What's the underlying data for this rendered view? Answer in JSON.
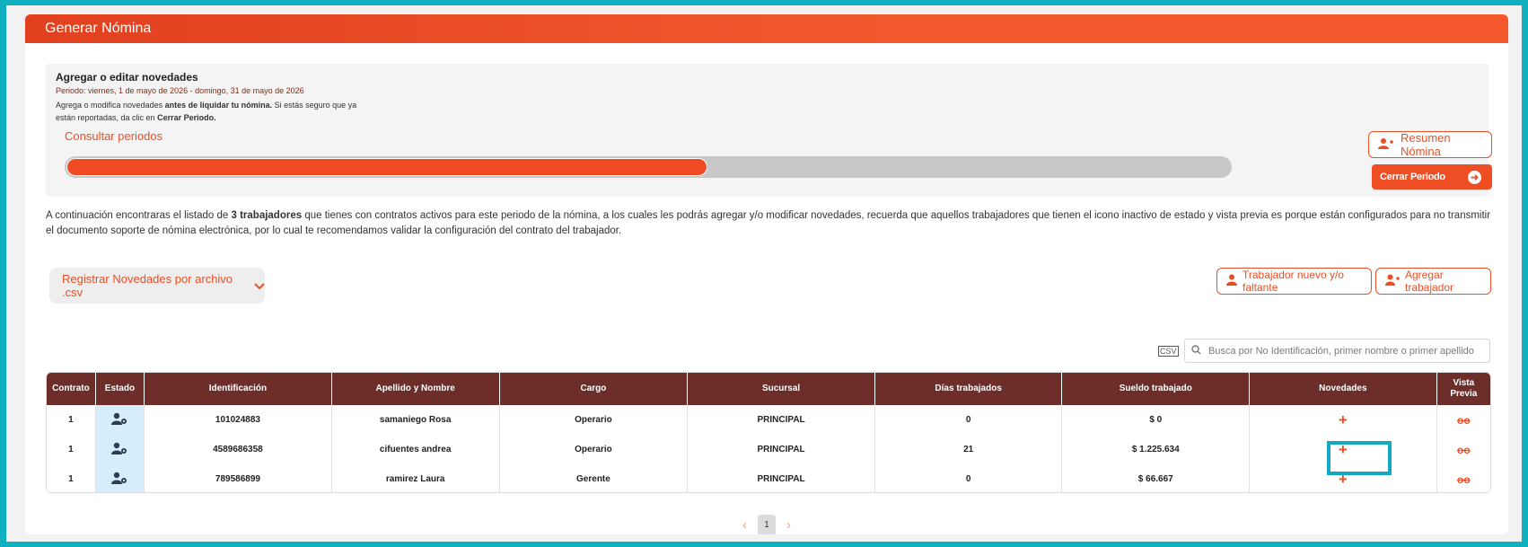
{
  "header": {
    "title": "Generar Nómina"
  },
  "novedades": {
    "title": "Agregar o editar novedades",
    "period": "Periodo: viernes, 1 de mayo de 2026 - domingo, 31 de mayo de 2026",
    "desc_part1": "Agrega o modifica novedades ",
    "desc_bold": "antes de liquidar tu nómina.",
    "desc_part2": " Si estás seguro que ya están reportadas, da clic en ",
    "desc_bold2": "Cerrar Periodo.",
    "consult_link": "Consultar periodos",
    "progress": 0.55,
    "resumen_button": "Resumen Nómina",
    "cerrar_button": "Cerrar Periodo"
  },
  "info": {
    "part1": "A continuación encontraras el listado de ",
    "bold": "3 trabajadores",
    "part2": " que tienes con contratos activos para este periodo de la nómina, a los cuales les podrás agregar y/o modificar novedades, recuerda que aquellos trabajadores que tienen el icono inactivo de estado y vista previa es porque están configurados para no transmitir el documento soporte de nómina electrónica, por lo cual te recomendamos validar la configuración del contrato del trabajador."
  },
  "actions": {
    "csv_button": "Registrar Novedades por archivo .csv",
    "nuevo_button": "Trabajador nuevo y/o faltante",
    "agregar_button": "Agregar trabajador"
  },
  "search": {
    "placeholder": "Busca por No Identificación, primer nombre o primer apellido",
    "csv_label": "CSV"
  },
  "table": {
    "columns": [
      "Contrato",
      "Estado",
      "Identificación",
      "Apellido y Nombre",
      "Cargo",
      "Sucursal",
      "Días trabajados",
      "Sueldo trabajado",
      "Novedades",
      "Vista Previa"
    ],
    "rows": [
      {
        "contrato": "1",
        "identificacion": "101024883",
        "nombre": "samaniego Rosa",
        "cargo": "Operario",
        "sucursal": "PRINCIPAL",
        "dias": "0",
        "sueldo": "$ 0"
      },
      {
        "contrato": "1",
        "identificacion": "4589686358",
        "nombre": "cifuentes andrea",
        "cargo": "Operario",
        "sucursal": "PRINCIPAL",
        "dias": "21",
        "sueldo": "$ 1.225.634"
      },
      {
        "contrato": "1",
        "identificacion": "789586899",
        "nombre": "ramirez Laura",
        "cargo": "Gerente",
        "sucursal": "PRINCIPAL",
        "dias": "0",
        "sueldo": "$ 66.667"
      }
    ]
  },
  "pagination": {
    "current": "1",
    "prev": "‹",
    "next": "›"
  },
  "colors": {
    "accent": "#ef4e24",
    "table_header": "#6d2e2a",
    "highlight": "#13a9c1"
  },
  "icons": {
    "plus": "+",
    "glasses": "oo"
  }
}
